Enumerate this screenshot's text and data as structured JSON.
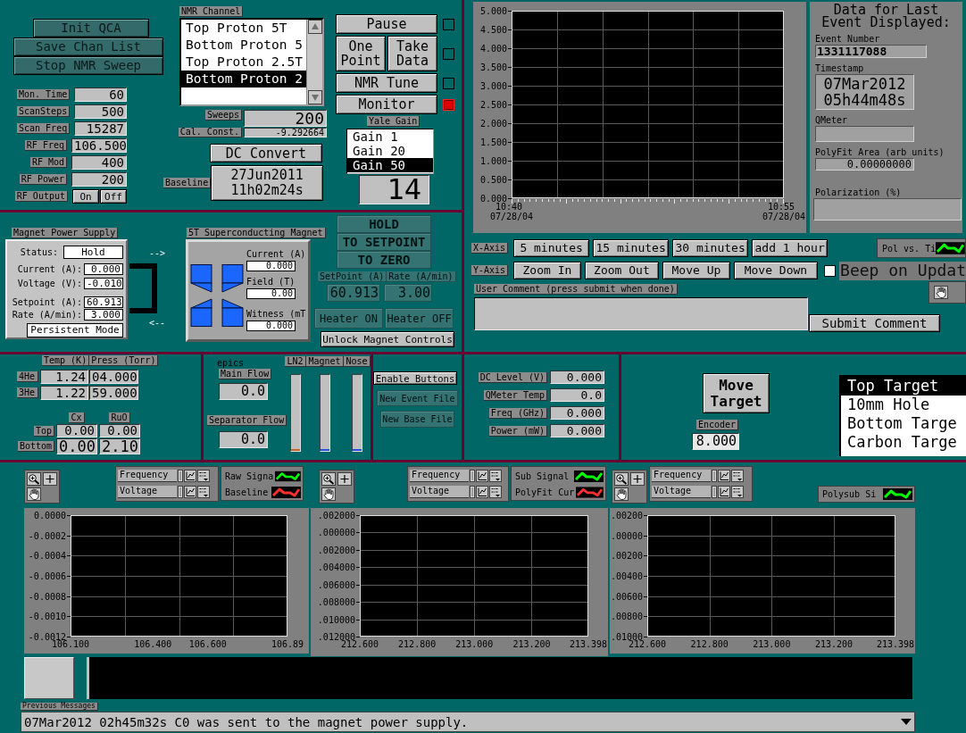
{
  "nmr_panel": {
    "buttons": [
      "Init QCA",
      "Save Chan List",
      "Stop NMR Sweep"
    ],
    "settings": [
      {
        "label": "Mon. Time",
        "value": "60"
      },
      {
        "label": "ScanSteps",
        "value": "500"
      },
      {
        "label": "Scan Freq",
        "value": "15287"
      },
      {
        "label": "RF Freq",
        "value": "106.500"
      },
      {
        "label": "RF Mod",
        "value": "400"
      },
      {
        "label": "RF Power",
        "value": "200"
      }
    ],
    "rf_output": {
      "label": "RF Output",
      "buttons": [
        "On",
        "Off"
      ]
    },
    "channel": {
      "label": "NMR Channel",
      "items": [
        {
          "label": "Top Proton 5T",
          "selected": false
        },
        {
          "label": "Bottom Proton 5",
          "selected": false
        },
        {
          "label": "Top Proton 2.5T",
          "selected": false
        },
        {
          "label": "Bottom Proton 2",
          "selected": true
        }
      ]
    },
    "sweeps": {
      "label": "Sweeps",
      "value": "200"
    },
    "cal_const": {
      "label": "Cal. Const.",
      "value": "-9.292664"
    },
    "dc_convert": "DC Convert",
    "baseline": {
      "label": "Baseline",
      "value": "27Jun2011 11h02m24s"
    },
    "run_controls": [
      {
        "buttons": [
          "Pause"
        ],
        "on": false
      },
      {
        "buttons": [
          "One Point",
          "Take Data"
        ],
        "on": false
      },
      {
        "buttons": [
          "NMR Tune"
        ],
        "on": false
      },
      {
        "buttons": [
          "Monitor"
        ],
        "on": true
      }
    ],
    "yale_gain": {
      "label": "Yale Gain",
      "options": [
        {
          "label": "Gain 1",
          "selected": false
        },
        {
          "label": "Gain 20",
          "selected": false
        },
        {
          "label": "Gain 50",
          "selected": true
        }
      ],
      "value": "14"
    }
  },
  "magnet_panel": {
    "power_supply": {
      "title": "Magnet Power Supply",
      "status_label": "Status:",
      "status": "Hold",
      "readings": [
        {
          "label": "Current (A):",
          "value": "0.000"
        },
        {
          "label": "Voltage (V):",
          "value": "-0.010"
        },
        {
          "label": "Setpoint (A):",
          "value": "60.913"
        },
        {
          "label": "Rate (A/min):",
          "value": "3.000"
        }
      ],
      "mode": "Persistent Mode"
    },
    "arrows": [
      "-->",
      "<--"
    ],
    "magnet": {
      "title": "5T Superconducting Magnet",
      "readings": [
        {
          "label": "Current (A)",
          "value": "0.000"
        },
        {
          "label": "Field (T)",
          "value": "0.00"
        },
        {
          "label": "Witness (mT",
          "value": "0.000"
        }
      ]
    },
    "ramp_buttons": [
      {
        "label": "HOLD",
        "disabled": true
      },
      {
        "label": "TO SETPOINT",
        "disabled": true
      },
      {
        "label": "TO ZERO",
        "disabled": true
      }
    ],
    "ramp_settings": [
      {
        "label": "SetPoint (A)",
        "value": "60.913",
        "disabled": true
      },
      {
        "label": "Rate (A/min)",
        "value": "3.00",
        "disabled": true
      }
    ],
    "heater_buttons": [
      {
        "label": "Heater ON",
        "disabled": true
      },
      {
        "label": "Heater OFF",
        "disabled": true
      }
    ],
    "unlock_button": {
      "label": "Unlock Magnet Controls",
      "disabled": false
    }
  },
  "trend_panel": {
    "chart_data": {
      "type": "line",
      "orientation": "vertical",
      "grid": true,
      "categories": [
        "10:40 07/28/04",
        "10:55 07/28/04"
      ],
      "ylim": [
        0,
        5
      ],
      "yticks": [
        {
          "value": 0,
          "label": "0.000"
        },
        {
          "value": 0.5,
          "label": "0.500"
        },
        {
          "value": 1,
          "label": "1.000"
        },
        {
          "value": 1.5,
          "label": "1.500"
        },
        {
          "value": 2,
          "label": "2.000"
        },
        {
          "value": 2.5,
          "label": "2.500"
        },
        {
          "value": 3,
          "label": "3.000"
        },
        {
          "value": 3.5,
          "label": "3.500"
        },
        {
          "value": 4,
          "label": "4.000"
        },
        {
          "value": 4.5,
          "label": "4.500"
        },
        {
          "value": 5,
          "label": "5.000"
        }
      ],
      "ref_lines": [
        {
          "axis": "y",
          "value": 0.5
        },
        {
          "axis": "y",
          "value": 1
        },
        {
          "axis": "y",
          "value": 1.5
        },
        {
          "axis": "y",
          "value": 2
        },
        {
          "axis": "y",
          "value": 2.5
        },
        {
          "axis": "y",
          "value": 3
        },
        {
          "axis": "y",
          "value": 3.5
        },
        {
          "axis": "y",
          "value": 4
        },
        {
          "axis": "y",
          "value": 4.5
        }
      ]
    },
    "event_data": {
      "title": "Data for Last Event Displayed:",
      "event_number": {
        "label": "Event Number",
        "value": "1331117088"
      },
      "timestamp": {
        "label": "Timestamp",
        "value": "07Mar2012 05h44m48s"
      },
      "qmeter": {
        "label": "QMeter"
      },
      "polyfit_area": {
        "label": "PolyFit Area (arb units)",
        "value": "0.00000000"
      },
      "polarization": {
        "label": "Polarization (%)"
      }
    },
    "x_axis": {
      "label": "X-Axis",
      "buttons": [
        "5 minutes",
        "15 minutes",
        "30 minutes",
        "add 1 hour"
      ]
    },
    "legend": {
      "label": "Pol vs. Ti"
    },
    "y_axis": {
      "label": "Y-Axis",
      "buttons": [
        "Zoom In",
        "Zoom Out",
        "Move Up",
        "Move Down"
      ]
    },
    "beep": {
      "label": "Beep on Updat",
      "checked": false
    },
    "comment": {
      "label": "User Comment (press submit when done)",
      "button": "Submit Comment"
    }
  },
  "cryo_panel": {
    "columns": [
      "Temp (K)",
      "Press (Torr)"
    ],
    "rows": [
      {
        "label": "4He",
        "values": [
          "1.24",
          "04.000"
        ]
      },
      {
        "label": "3He",
        "values": [
          "1.22",
          "59.000"
        ]
      }
    ],
    "resistor_columns": [
      "Cx",
      "RuO"
    ],
    "resistor_rows": [
      {
        "label": "Top",
        "values": [
          "0.00",
          "0.00"
        ]
      },
      {
        "label": "Bottom",
        "values": [
          "0.00",
          "2.10"
        ]
      }
    ]
  },
  "epics_panel": {
    "title": "epics",
    "flows": [
      {
        "label": "Main Flow",
        "value": "0.0"
      },
      {
        "label": "Separator Flow",
        "value": "0.0"
      }
    ],
    "gauges": [
      {
        "label": "LN2",
        "level": 0.02,
        "color": "#c8641e"
      },
      {
        "label": "Magnet",
        "level": 0.02,
        "color": "#2850e0"
      },
      {
        "label": "Nose",
        "level": 0.02,
        "color": "#2850e0"
      }
    ]
  },
  "file_panel": {
    "buttons": [
      {
        "label": "Enable Buttons",
        "disabled": false
      },
      {
        "label": "New Event File",
        "disabled": true
      },
      {
        "label": "New Base File",
        "disabled": true
      }
    ]
  },
  "qmeter_panel": {
    "readings": [
      {
        "label": "DC Level (V)",
        "value": "0.000"
      },
      {
        "label": "QMeter Temp",
        "value": "0.0"
      },
      {
        "label": "Freq (GHz)",
        "value": "0.000"
      },
      {
        "label": "Power (mW)",
        "value": "0.000"
      }
    ]
  },
  "target_panel": {
    "button": "Move Target",
    "encoder": {
      "label": "Encoder",
      "value": "8.000"
    },
    "positions": [
      {
        "label": "Top Target",
        "selected": true
      },
      {
        "label": "10mm Hole",
        "selected": false
      },
      {
        "label": "Bottom Targe",
        "selected": false
      },
      {
        "label": "Carbon Targe",
        "selected": false
      }
    ]
  },
  "graphs": [
    {
      "scales": [
        "Frequency",
        "Voltage"
      ],
      "legend": [
        {
          "name": "Raw Signa",
          "color": "#00ff00"
        },
        {
          "name": "Baseline",
          "color": "#ff3030"
        }
      ],
      "chart_data": {
        "type": "line",
        "grid": true,
        "xlim": [
          106.1,
          106.89
        ],
        "ylim": [
          -0.0012,
          0
        ],
        "xticks": [
          {
            "value": 106.1,
            "label": "106.100"
          },
          {
            "value": 106.4,
            "label": "106.400"
          },
          {
            "value": 106.6,
            "label": "106.600"
          },
          {
            "value": 106.89,
            "label": "106.89"
          }
        ],
        "yticks": [
          {
            "value": 0,
            "label": "0.0000"
          },
          {
            "value": -0.0002,
            "label": "-0.0002"
          },
          {
            "value": -0.0004,
            "label": "-0.0004"
          },
          {
            "value": -0.0006,
            "label": "-0.0006"
          },
          {
            "value": -0.0008,
            "label": "-0.0008"
          },
          {
            "value": -0.001,
            "label": "-0.0010"
          },
          {
            "value": -0.0012,
            "label": "-0.0012"
          }
        ]
      }
    },
    {
      "scales": [
        "Frequency",
        "Voltage"
      ],
      "legend": [
        {
          "name": "Sub Signal",
          "color": "#00ff00"
        },
        {
          "name": "PolyFit Cur",
          "color": "#ff3030"
        }
      ],
      "chart_data": {
        "type": "line",
        "grid": true,
        "xlim": [
          212.6,
          213.398
        ],
        "ylim": [
          -0.012,
          0.002
        ],
        "xticks": [
          {
            "value": 212.6,
            "label": "212.600"
          },
          {
            "value": 212.8,
            "label": "212.800"
          },
          {
            "value": 213,
            "label": "213.000"
          },
          {
            "value": 213.2,
            "label": "213.200"
          },
          {
            "value": 213.398,
            "label": "213.398"
          }
        ],
        "yticks": [
          {
            "value": 0.002,
            "label": ".002000"
          },
          {
            "value": 0,
            "label": ".000000"
          },
          {
            "value": -0.002,
            "label": ".002000"
          },
          {
            "value": -0.004,
            "label": ".004000"
          },
          {
            "value": -0.006,
            "label": ".006000"
          },
          {
            "value": -0.008,
            "label": ".008000"
          },
          {
            "value": -0.01,
            "label": ".010000"
          },
          {
            "value": -0.012,
            "label": ".012000"
          }
        ]
      }
    },
    {
      "scales": [
        "Frequency",
        "Voltage"
      ],
      "legend": [
        {
          "name": "Polysub Si",
          "color": "#00ff00"
        }
      ],
      "chart_data": {
        "type": "line",
        "grid": true,
        "xlim": [
          212.6,
          213.398
        ],
        "ylim": [
          -0.01,
          0.002
        ],
        "xticks": [
          {
            "value": 212.6,
            "label": "212.600"
          },
          {
            "value": 212.8,
            "label": "212.800"
          },
          {
            "value": 213,
            "label": "213.000"
          },
          {
            "value": 213.2,
            "label": "213.200"
          },
          {
            "value": 213.398,
            "label": "213.398"
          }
        ],
        "yticks": [
          {
            "value": 0.002,
            "label": ".00200"
          },
          {
            "value": 0,
            "label": ".00000"
          },
          {
            "value": -0.002,
            "label": ".00200"
          },
          {
            "value": -0.004,
            "label": ".00400"
          },
          {
            "value": -0.006,
            "label": ".00600"
          },
          {
            "value": -0.008,
            "label": ".00800"
          },
          {
            "value": -0.01,
            "label": ".01000"
          }
        ]
      }
    }
  ],
  "messages": {
    "label": "Previous Messages",
    "text": "07Mar2012 02h45m32s C0 was sent to the magnet power supply."
  }
}
